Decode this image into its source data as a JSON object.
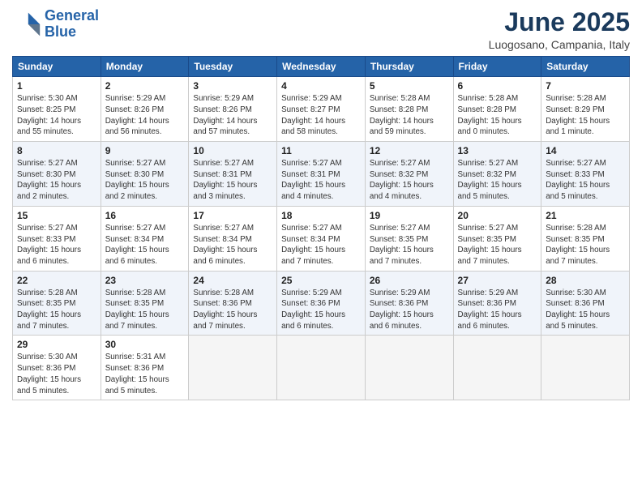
{
  "header": {
    "logo_line1": "General",
    "logo_line2": "Blue",
    "month": "June 2025",
    "location": "Luogosano, Campania, Italy"
  },
  "weekdays": [
    "Sunday",
    "Monday",
    "Tuesday",
    "Wednesday",
    "Thursday",
    "Friday",
    "Saturday"
  ],
  "weeks": [
    [
      {
        "day": "1",
        "info": "Sunrise: 5:30 AM\nSunset: 8:25 PM\nDaylight: 14 hours\nand 55 minutes."
      },
      {
        "day": "2",
        "info": "Sunrise: 5:29 AM\nSunset: 8:26 PM\nDaylight: 14 hours\nand 56 minutes."
      },
      {
        "day": "3",
        "info": "Sunrise: 5:29 AM\nSunset: 8:26 PM\nDaylight: 14 hours\nand 57 minutes."
      },
      {
        "day": "4",
        "info": "Sunrise: 5:29 AM\nSunset: 8:27 PM\nDaylight: 14 hours\nand 58 minutes."
      },
      {
        "day": "5",
        "info": "Sunrise: 5:28 AM\nSunset: 8:28 PM\nDaylight: 14 hours\nand 59 minutes."
      },
      {
        "day": "6",
        "info": "Sunrise: 5:28 AM\nSunset: 8:28 PM\nDaylight: 15 hours\nand 0 minutes."
      },
      {
        "day": "7",
        "info": "Sunrise: 5:28 AM\nSunset: 8:29 PM\nDaylight: 15 hours\nand 1 minute."
      }
    ],
    [
      {
        "day": "8",
        "info": "Sunrise: 5:27 AM\nSunset: 8:30 PM\nDaylight: 15 hours\nand 2 minutes."
      },
      {
        "day": "9",
        "info": "Sunrise: 5:27 AM\nSunset: 8:30 PM\nDaylight: 15 hours\nand 2 minutes."
      },
      {
        "day": "10",
        "info": "Sunrise: 5:27 AM\nSunset: 8:31 PM\nDaylight: 15 hours\nand 3 minutes."
      },
      {
        "day": "11",
        "info": "Sunrise: 5:27 AM\nSunset: 8:31 PM\nDaylight: 15 hours\nand 4 minutes."
      },
      {
        "day": "12",
        "info": "Sunrise: 5:27 AM\nSunset: 8:32 PM\nDaylight: 15 hours\nand 4 minutes."
      },
      {
        "day": "13",
        "info": "Sunrise: 5:27 AM\nSunset: 8:32 PM\nDaylight: 15 hours\nand 5 minutes."
      },
      {
        "day": "14",
        "info": "Sunrise: 5:27 AM\nSunset: 8:33 PM\nDaylight: 15 hours\nand 5 minutes."
      }
    ],
    [
      {
        "day": "15",
        "info": "Sunrise: 5:27 AM\nSunset: 8:33 PM\nDaylight: 15 hours\nand 6 minutes."
      },
      {
        "day": "16",
        "info": "Sunrise: 5:27 AM\nSunset: 8:34 PM\nDaylight: 15 hours\nand 6 minutes."
      },
      {
        "day": "17",
        "info": "Sunrise: 5:27 AM\nSunset: 8:34 PM\nDaylight: 15 hours\nand 6 minutes."
      },
      {
        "day": "18",
        "info": "Sunrise: 5:27 AM\nSunset: 8:34 PM\nDaylight: 15 hours\nand 7 minutes."
      },
      {
        "day": "19",
        "info": "Sunrise: 5:27 AM\nSunset: 8:35 PM\nDaylight: 15 hours\nand 7 minutes."
      },
      {
        "day": "20",
        "info": "Sunrise: 5:27 AM\nSunset: 8:35 PM\nDaylight: 15 hours\nand 7 minutes."
      },
      {
        "day": "21",
        "info": "Sunrise: 5:28 AM\nSunset: 8:35 PM\nDaylight: 15 hours\nand 7 minutes."
      }
    ],
    [
      {
        "day": "22",
        "info": "Sunrise: 5:28 AM\nSunset: 8:35 PM\nDaylight: 15 hours\nand 7 minutes."
      },
      {
        "day": "23",
        "info": "Sunrise: 5:28 AM\nSunset: 8:35 PM\nDaylight: 15 hours\nand 7 minutes."
      },
      {
        "day": "24",
        "info": "Sunrise: 5:28 AM\nSunset: 8:36 PM\nDaylight: 15 hours\nand 7 minutes."
      },
      {
        "day": "25",
        "info": "Sunrise: 5:29 AM\nSunset: 8:36 PM\nDaylight: 15 hours\nand 6 minutes."
      },
      {
        "day": "26",
        "info": "Sunrise: 5:29 AM\nSunset: 8:36 PM\nDaylight: 15 hours\nand 6 minutes."
      },
      {
        "day": "27",
        "info": "Sunrise: 5:29 AM\nSunset: 8:36 PM\nDaylight: 15 hours\nand 6 minutes."
      },
      {
        "day": "28",
        "info": "Sunrise: 5:30 AM\nSunset: 8:36 PM\nDaylight: 15 hours\nand 5 minutes."
      }
    ],
    [
      {
        "day": "29",
        "info": "Sunrise: 5:30 AM\nSunset: 8:36 PM\nDaylight: 15 hours\nand 5 minutes."
      },
      {
        "day": "30",
        "info": "Sunrise: 5:31 AM\nSunset: 8:36 PM\nDaylight: 15 hours\nand 5 minutes."
      },
      {
        "day": "",
        "info": ""
      },
      {
        "day": "",
        "info": ""
      },
      {
        "day": "",
        "info": ""
      },
      {
        "day": "",
        "info": ""
      },
      {
        "day": "",
        "info": ""
      }
    ]
  ]
}
